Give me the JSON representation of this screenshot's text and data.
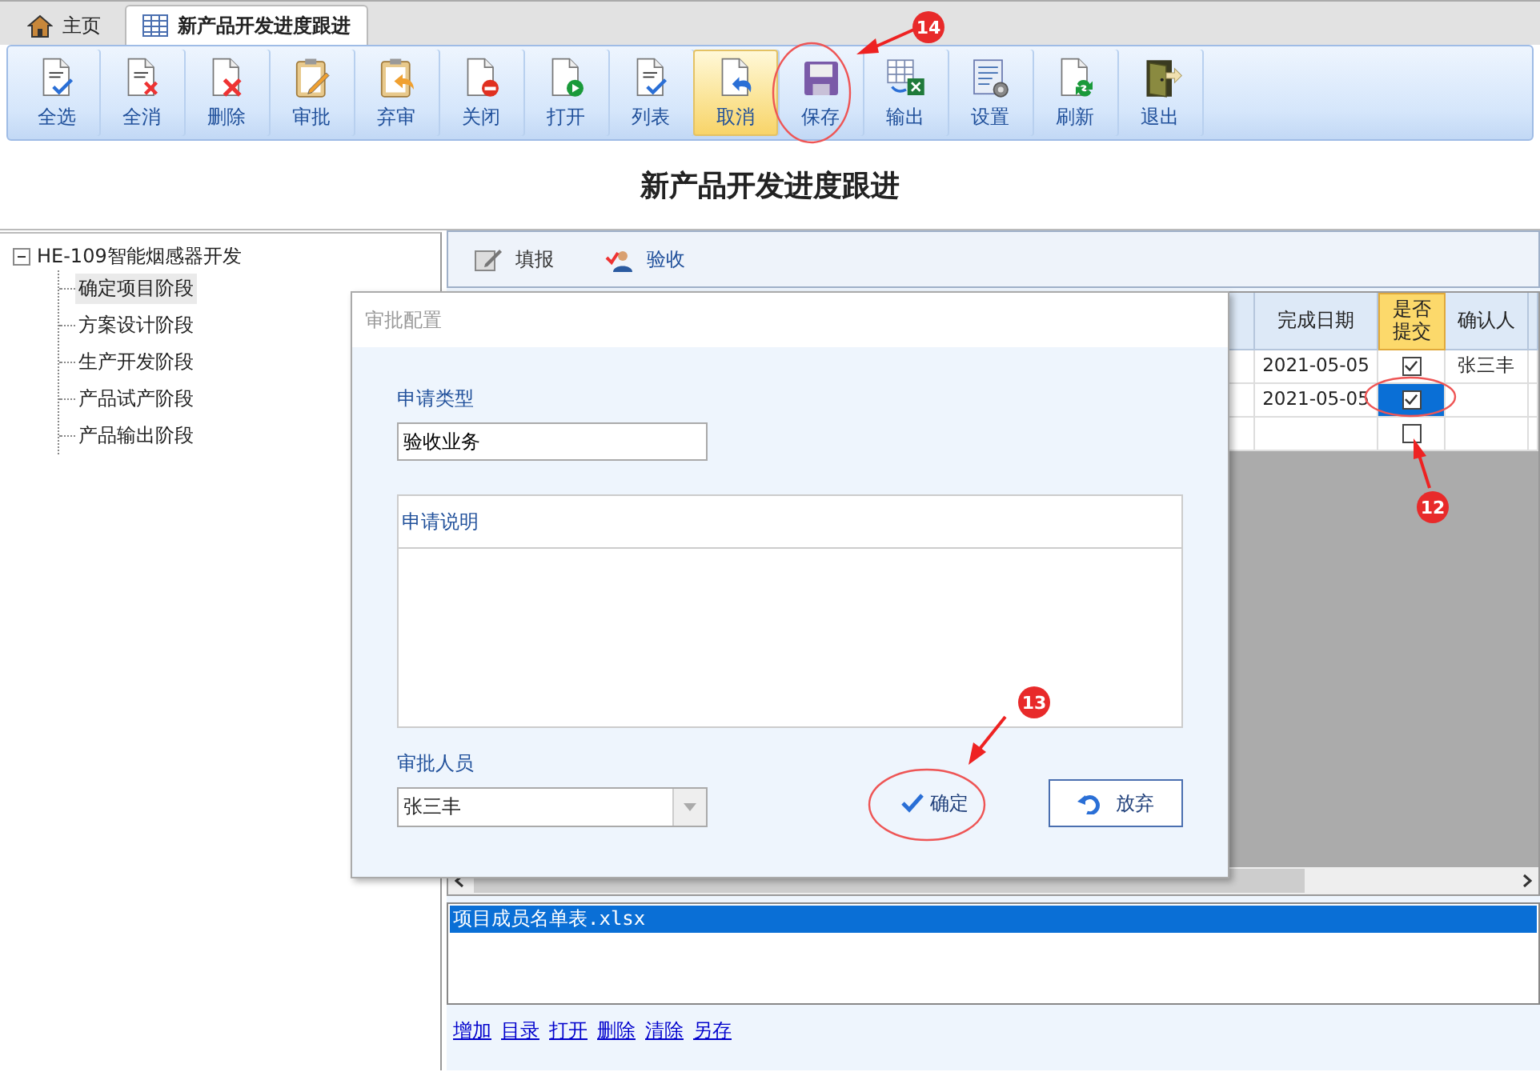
{
  "tabs": [
    {
      "label": "主页",
      "selected": false
    },
    {
      "label": "新产品开发进度跟进",
      "selected": true
    }
  ],
  "toolbar": [
    {
      "label": "全选",
      "selected": false
    },
    {
      "label": "全消",
      "selected": false
    },
    {
      "label": "删除",
      "selected": false
    },
    {
      "label": "审批",
      "selected": false
    },
    {
      "label": "弃审",
      "selected": false
    },
    {
      "label": "关闭",
      "selected": false
    },
    {
      "label": "打开",
      "selected": false
    },
    {
      "label": "列表",
      "selected": false
    },
    {
      "label": "取消",
      "selected": true
    },
    {
      "label": "保存",
      "selected": false
    },
    {
      "label": "输出",
      "selected": false
    },
    {
      "label": "设置",
      "selected": false
    },
    {
      "label": "刷新",
      "selected": false
    },
    {
      "label": "退出",
      "selected": false
    }
  ],
  "page_title": "新产品开发进度跟进",
  "tree": {
    "label": "HE-109智能烟感器开发",
    "expanded": true,
    "children": [
      {
        "label": "确定项目阶段",
        "selected": true
      },
      {
        "label": "方案设计阶段",
        "selected": false
      },
      {
        "label": "生产开发阶段",
        "selected": false
      },
      {
        "label": "产品试产阶段",
        "selected": false
      },
      {
        "label": "产品输出阶段",
        "selected": false
      }
    ]
  },
  "subtoolbar": [
    "填报",
    "验收"
  ],
  "grid": {
    "columns": [
      {
        "label": "完成日期",
        "highlighted": false
      },
      {
        "label": "是否提交",
        "highlighted": true
      },
      {
        "label": "确认人",
        "highlighted": false
      }
    ],
    "rows": [
      {
        "date": "2021-05-05",
        "submitted": true,
        "selected": false,
        "confirmer": "张三丰"
      },
      {
        "date": "2021-05-05",
        "submitted": true,
        "selected": true
      },
      {
        "submitted": false,
        "selected": false
      }
    ]
  },
  "attachments": [
    {
      "name": "项目成员名单表.xlsx",
      "selected": true
    }
  ],
  "attachment_links": [
    "增加",
    "目录",
    "打开",
    "删除",
    "清除",
    "另存"
  ],
  "dialog": {
    "title": "审批配置",
    "type_label": "申请类型",
    "type_value": "验收业务",
    "note_label": "申请说明",
    "approver_label": "审批人员",
    "approver_value": "张三丰",
    "buttons": [
      "确定",
      "放弃"
    ]
  },
  "annotations": [
    {
      "label": "14"
    },
    {
      "label": "12"
    },
    {
      "label": "13"
    }
  ]
}
